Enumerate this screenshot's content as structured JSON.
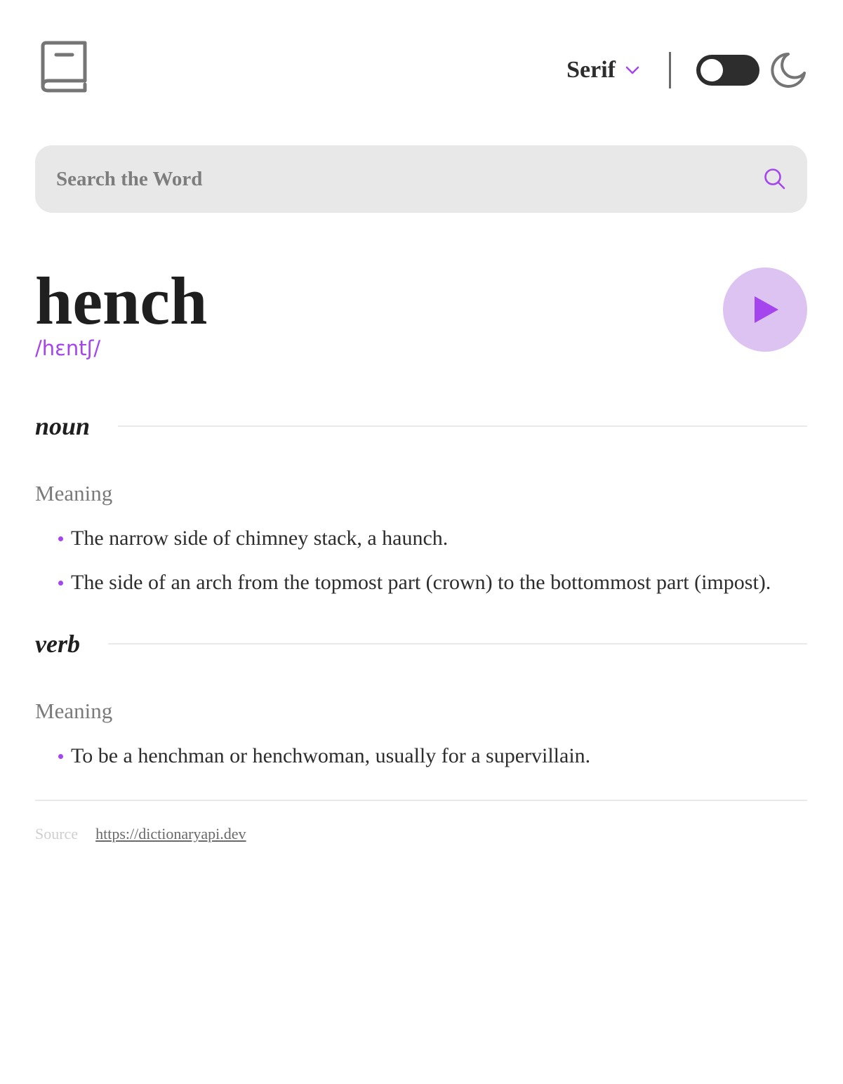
{
  "header": {
    "logo_icon": "book-icon",
    "font_selector": {
      "selected": "Serif",
      "icon": "chevron-down-icon"
    },
    "theme_toggle": {
      "state": "off",
      "icon": "moon-icon"
    }
  },
  "search": {
    "placeholder": "Search the Word",
    "value": "",
    "icon": "search-icon"
  },
  "entry": {
    "word": "hench",
    "phonetic": "/hɛntʃ/",
    "play_icon": "play-icon",
    "meanings": [
      {
        "part_of_speech": "noun",
        "label": "Meaning",
        "definitions": [
          "The narrow side of chimney stack, a haunch.",
          "The side of an arch from the topmost part (crown) to the bottommost part (impost)."
        ]
      },
      {
        "part_of_speech": "verb",
        "label": "Meaning",
        "definitions": [
          "To be a henchman or henchwoman, usually for a supervillain."
        ]
      }
    ]
  },
  "footer": {
    "source_label": "Source",
    "source_url": "https://dictionaryapi.dev"
  },
  "colors": {
    "accent": "#a445ed",
    "accent_light": "#dcc3f2",
    "text_dark": "#2d2d2d",
    "text_muted": "#757575",
    "search_bg": "#e8e8e8"
  }
}
